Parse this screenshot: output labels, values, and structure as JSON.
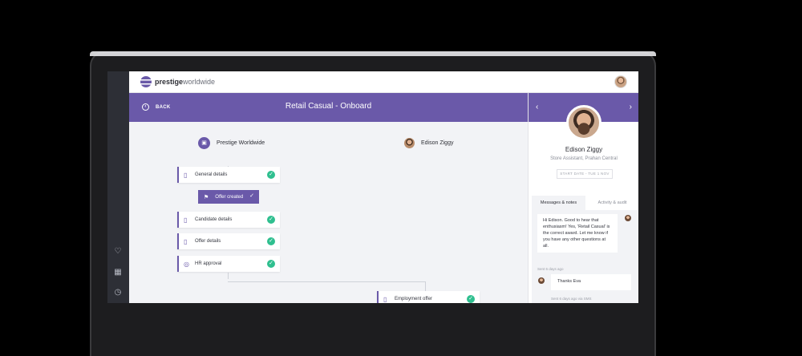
{
  "app": {
    "logo_bold": "prestige",
    "logo_light": "worldwide"
  },
  "header": {
    "back_label": "BACK",
    "title": "Retail Casual - Onboard"
  },
  "flow": {
    "employer": "Prestige Worldwide",
    "candidate": "Edison Ziggy",
    "steps": [
      {
        "label": "General details",
        "done": true
      },
      {
        "label": "Candidate details",
        "done": true
      },
      {
        "label": "Offer details",
        "done": true
      },
      {
        "label": "HR approval",
        "done": true
      },
      {
        "label": "Employment offer",
        "done": true
      }
    ],
    "offer_badge": "Offer created"
  },
  "profile": {
    "name": "Edison Ziggy",
    "role": "Store Assistant, Prahan Central",
    "start_date": "START DATE - TUE 1 NOV"
  },
  "tabs": [
    {
      "label": "Messages & notes",
      "active": true
    },
    {
      "label": "Activity & audit",
      "active": false
    }
  ],
  "messages": [
    {
      "text": "Hi Edison. Good to hear that enthusiasm! Yes, 'Retail Casual' is the correct award. Let me know if you have any other questions at all.",
      "meta": "Sent 6 days ago"
    },
    {
      "text": "Thanks Eva",
      "meta": "Sent 6 days ago via SMS"
    }
  ],
  "colors": {
    "primary": "#6a59a9",
    "success": "#2fbf8f",
    "rail": "#2d2f36"
  }
}
